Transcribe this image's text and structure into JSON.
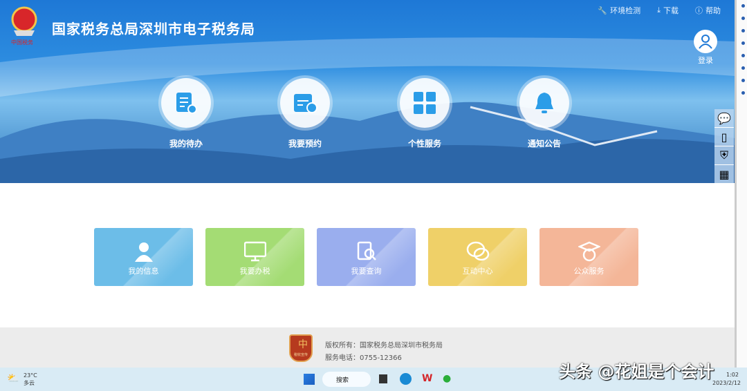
{
  "header": {
    "title": "国家税务总局深圳市电子税务局",
    "logo_text": "中国税务",
    "links": [
      {
        "label": "环境检测",
        "icon": "wrench-icon"
      },
      {
        "label": "下载",
        "icon": "download-icon"
      },
      {
        "label": "帮助",
        "icon": "help-icon"
      }
    ],
    "login_label": "登录"
  },
  "nav": [
    {
      "label": "我的待办",
      "icon": "todo-icon"
    },
    {
      "label": "我要预约",
      "icon": "calendar-icon"
    },
    {
      "label": "个性服务",
      "icon": "grid-icon"
    },
    {
      "label": "通知公告",
      "icon": "bell-icon"
    }
  ],
  "tiles": [
    {
      "label": "我的信息",
      "color": "#6cbde8"
    },
    {
      "label": "我要办税",
      "color": "#a4dc74"
    },
    {
      "label": "我要查询",
      "color": "#9aaeee"
    },
    {
      "label": "互动中心",
      "color": "#efd068"
    },
    {
      "label": "公众服务",
      "color": "#f4b698"
    }
  ],
  "footer": {
    "copyright": "版权所有：国家税务总局深圳市税务局",
    "phone": "服务电话：0755-12366",
    "badge_text": "税收宣传"
  },
  "taskbar": {
    "temp": "23°C",
    "weather": "多云",
    "search": "搜索",
    "time": "1:02",
    "date": "2023/2/12"
  },
  "watermark": "头条 @花姐是个会计"
}
